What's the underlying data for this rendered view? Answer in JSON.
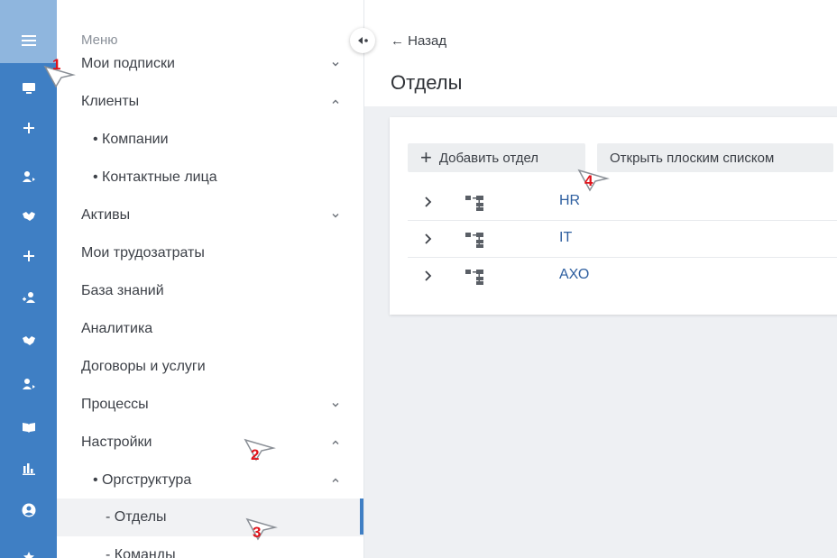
{
  "menu": {
    "header": "Меню",
    "items": [
      {
        "label": "Мои подписки",
        "level": 0,
        "chevron": "down"
      },
      {
        "label": "Клиенты",
        "level": 0,
        "chevron": "up"
      },
      {
        "label": "• Компании",
        "level": 1
      },
      {
        "label": "• Контактные лица",
        "level": 1
      },
      {
        "label": "Активы",
        "level": 0,
        "chevron": "down"
      },
      {
        "label": "Мои трудозатраты",
        "level": 0
      },
      {
        "label": "База знаний",
        "level": 0
      },
      {
        "label": "Аналитика",
        "level": 0
      },
      {
        "label": "Договоры и услуги",
        "level": 0
      },
      {
        "label": "Процессы",
        "level": 0,
        "chevron": "down"
      },
      {
        "label": "Настройки",
        "level": 0,
        "chevron": "up"
      },
      {
        "label": "• Оргструктура",
        "level": 1,
        "chevron": "up"
      },
      {
        "label": "- Отделы",
        "level": 2,
        "active": true
      },
      {
        "label": "- Команды",
        "level": 2
      }
    ]
  },
  "rail": {
    "icons": [
      "menu-icon",
      "monitor-icon",
      "plus-icon",
      "user-arrow-icon",
      "handshake-icon",
      "plus-icon",
      "user-add-icon",
      "handshake-icon",
      "user-arrow-icon",
      "book-icon",
      "chart-icon",
      "account-circle-icon",
      "star-icon"
    ]
  },
  "main": {
    "back_label": "← Назад",
    "title": "Отделы",
    "add_button": "Добавить отдел",
    "add_button_icon": "+",
    "flat_button": "Открыть плоским списком",
    "departments": [
      "HR",
      "IT",
      "АХО"
    ]
  },
  "annotations": [
    "1",
    "2",
    "3",
    "4"
  ],
  "colors": {
    "accent": "#3f7fc4",
    "rail_top": "#8fb6de",
    "link": "#2e5fa0",
    "annotation": "#e0121a"
  }
}
